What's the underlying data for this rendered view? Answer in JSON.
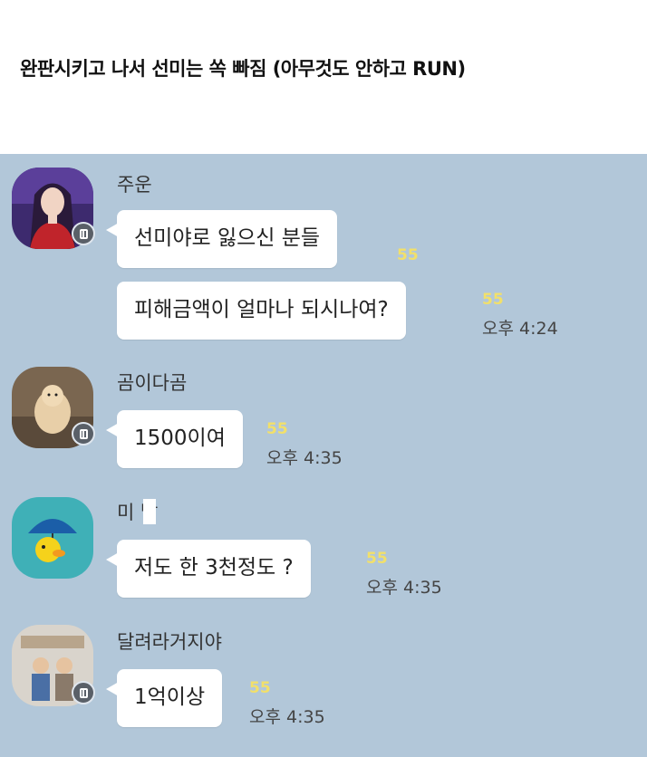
{
  "headline": "완판시키고 나서 선미는 쏙 빠짐 (아무것도 안하고 RUN)",
  "messages": [
    {
      "sender": "주운",
      "bubbles": [
        "선미야로 잃으신 분들",
        "피해금액이 얼마나 되시나여?"
      ],
      "unread": [
        "55",
        "55"
      ],
      "time": "오후 4:24"
    },
    {
      "sender": "곰이다곰",
      "bubbles": [
        "1500이여"
      ],
      "unread": [
        "55"
      ],
      "time": "오후 4:35"
    },
    {
      "sender": "미 발",
      "bubbles": [
        "저도 한 3천정도 ?"
      ],
      "unread": [
        "55"
      ],
      "time": "오후 4:35"
    },
    {
      "sender": "달려라거지야",
      "bubbles": [
        "1억이상"
      ],
      "unread": [
        "55"
      ],
      "time": "오후 4:35"
    }
  ],
  "colors": {
    "chat_background": "#b2c7d9",
    "unread_count": "#f2e06a",
    "bubble": "#ffffff"
  },
  "icons": [
    "profile-avatar",
    "channel-badge-icon"
  ]
}
